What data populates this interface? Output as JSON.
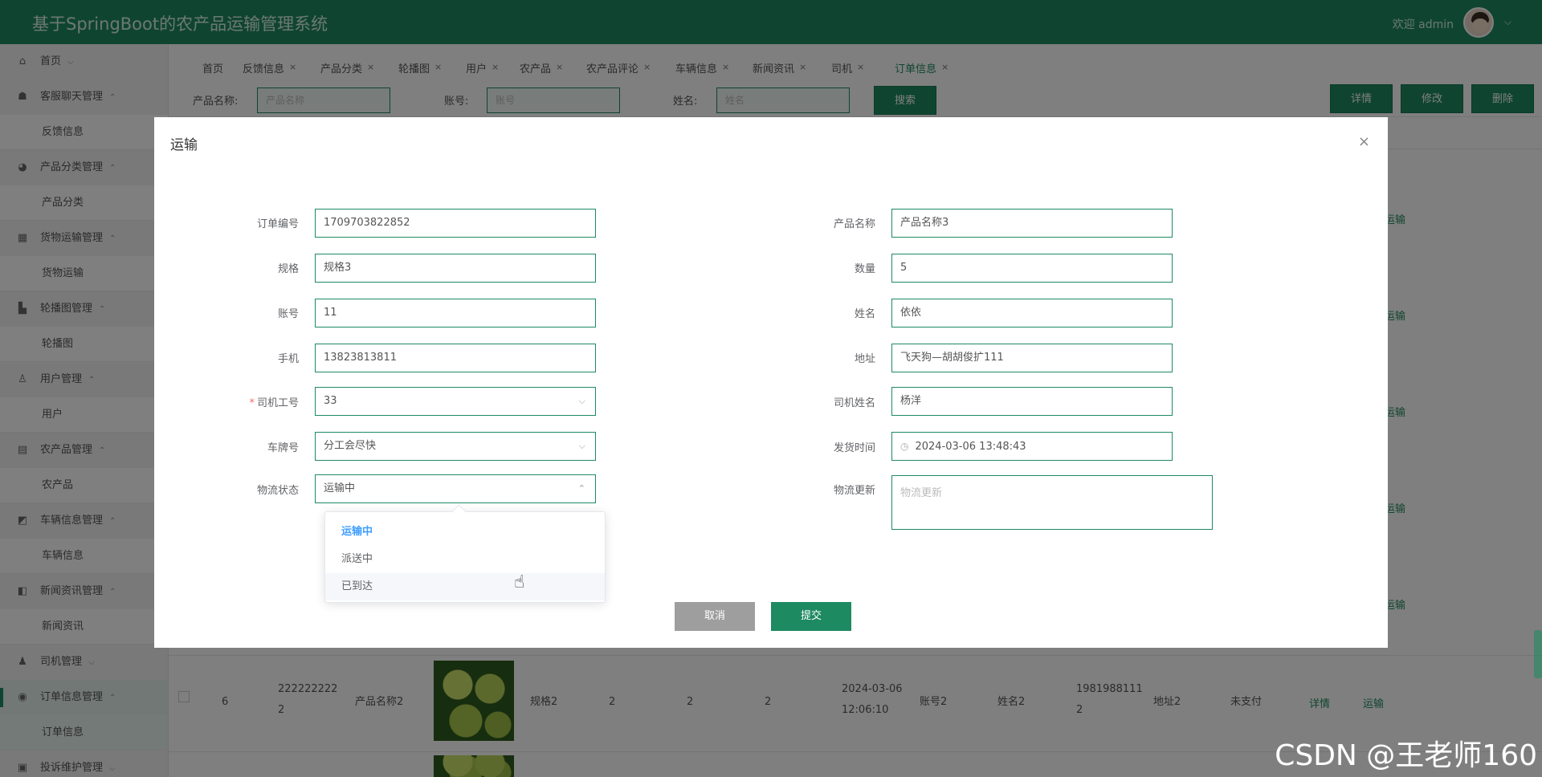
{
  "header": {
    "title": "基于SpringBoot的农产品运输管理系统",
    "welcome": "欢迎 admin",
    "caret": "⌵"
  },
  "sidebar": {
    "items": [
      {
        "label": "首页",
        "icon": "⌂",
        "arrow": "⌵"
      },
      {
        "label": "客服聊天管理",
        "icon": "☗",
        "arrow": "⌃",
        "sub": "反馈信息"
      },
      {
        "label": "产品分类管理",
        "icon": "◕",
        "arrow": "⌃",
        "sub": "产品分类"
      },
      {
        "label": "货物运输管理",
        "icon": "▦",
        "arrow": "⌃",
        "sub": "货物运输"
      },
      {
        "label": "轮播图管理",
        "icon": "▙",
        "arrow": "⌃",
        "sub": "轮播图"
      },
      {
        "label": "用户管理",
        "icon": "♙",
        "arrow": "⌃",
        "sub": "用户"
      },
      {
        "label": "农产品管理",
        "icon": "▤",
        "arrow": "⌃",
        "sub": "农产品"
      },
      {
        "label": "车辆信息管理",
        "icon": "◩",
        "arrow": "⌃",
        "sub": "车辆信息"
      },
      {
        "label": "新闻资讯管理",
        "icon": "◧",
        "arrow": "⌃",
        "sub": "新闻资讯"
      },
      {
        "label": "司机管理",
        "icon": "♟",
        "arrow": "⌵"
      },
      {
        "label": "订单信息管理",
        "icon": "◉",
        "arrow": "⌃",
        "sub": "订单信息"
      },
      {
        "label": "投诉维护管理",
        "icon": "▣",
        "arrow": "⌵"
      }
    ]
  },
  "tabs": [
    "首页",
    "反馈信息",
    "产品分类",
    "轮播图",
    "用户",
    "农产品",
    "农产品评论",
    "车辆信息",
    "新闻资讯",
    "司机",
    "订单信息"
  ],
  "tab_close": "×",
  "search": {
    "product_label": "产品名称:",
    "product_placeholder": "产品名称",
    "account_label": "账号:",
    "account_placeholder": "账号",
    "name_label": "姓名:",
    "name_placeholder": "姓名",
    "search_btn": "搜索"
  },
  "toolbar": {
    "detail": "详情",
    "edit": "修改",
    "delete": "删除"
  },
  "table_row": {
    "index": "6",
    "order_no_1": "222222222",
    "order_no_2": "2",
    "product": "产品名称2",
    "spec": "规格2",
    "c1": "2",
    "c2": "2",
    "c3": "2",
    "date": "2024-03-06",
    "time": "12:06:10",
    "account": "账号2",
    "name": "姓名2",
    "phone_1": "1981988111",
    "phone_2": "2",
    "address": "地址2",
    "status": "未支付",
    "detail_link": "详情",
    "ship_link": "运输"
  },
  "side_link": "运输",
  "modal": {
    "title": "运输",
    "close": "×",
    "fields": {
      "order_no": {
        "label": "订单编号",
        "value": "1709703822852"
      },
      "product_name": {
        "label": "产品名称",
        "value": "产品名称3"
      },
      "spec": {
        "label": "规格",
        "value": "规格3"
      },
      "quantity": {
        "label": "数量",
        "value": "5"
      },
      "account": {
        "label": "账号",
        "value": "11"
      },
      "name": {
        "label": "姓名",
        "value": "依依"
      },
      "phone": {
        "label": "手机",
        "value": "13823813811"
      },
      "address": {
        "label": "地址",
        "value": "飞天狗—胡胡俊扩111"
      },
      "driver_no": {
        "label": "司机工号",
        "value": "33",
        "required": "*"
      },
      "driver_name": {
        "label": "司机姓名",
        "value": "杨洋"
      },
      "plate": {
        "label": "车牌号",
        "value": "分工会尽快"
      },
      "ship_time": {
        "label": "发货时间",
        "value": "2024-03-06 13:48:43"
      },
      "logistics_status": {
        "label": "物流状态",
        "value": "运输中"
      },
      "logistics_update": {
        "label": "物流更新",
        "placeholder": "物流更新"
      }
    },
    "dropdown_options": [
      "运输中",
      "派送中",
      "已到达"
    ],
    "cancel": "取消",
    "submit": "提交"
  },
  "watermark": "CSDN @王老师160",
  "colors": {
    "primary": "#1e8a61",
    "selected_option": "#409eff",
    "cancel_btn": "#9e9e9e"
  }
}
